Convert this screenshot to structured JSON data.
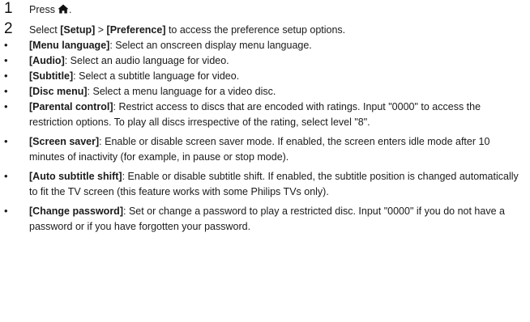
{
  "steps": [
    {
      "number": "1",
      "text": "Press",
      "icon": "home-icon",
      "after": "."
    },
    {
      "number": "2",
      "pre": "Select ",
      "term1": "[Setup]",
      "mid": " > ",
      "term2": "[Preference]",
      "post": " to access the preference setup options."
    }
  ],
  "bullet_symbol": "•",
  "bullets": [
    {
      "term": "[Menu language]",
      "text": ": Select an onscreen display menu language."
    },
    {
      "term": "[Audio]",
      "text": ": Select an audio language for video."
    },
    {
      "term": "[Subtitle]",
      "text": ": Select a subtitle language for video."
    },
    {
      "term": "[Disc menu]",
      "text": ": Select a menu language for a video disc."
    },
    {
      "term": "[Parental control]",
      "text": ": Restrict access to discs that are encoded with ratings. Input \"0000\" to access the restriction options. To play all discs irrespective of the rating, select level \"8\"."
    },
    {
      "term": "[Screen saver]",
      "text": ": Enable or disable screen saver mode. If enabled, the screen enters idle mode after 10 minutes of inactivity (for example, in pause or stop mode)."
    },
    {
      "term": "[Auto subtitle shift]",
      "text": ": Enable or disable subtitle shift. If enabled, the subtitle position is changed automatically to fit the TV screen (this feature works with some Philips TVs only)."
    },
    {
      "term": "[Change password]",
      "text": ": Set or change a password to play a restricted disc. Input \"0000\" if you do not have a password or if you have forgotten your password."
    }
  ]
}
